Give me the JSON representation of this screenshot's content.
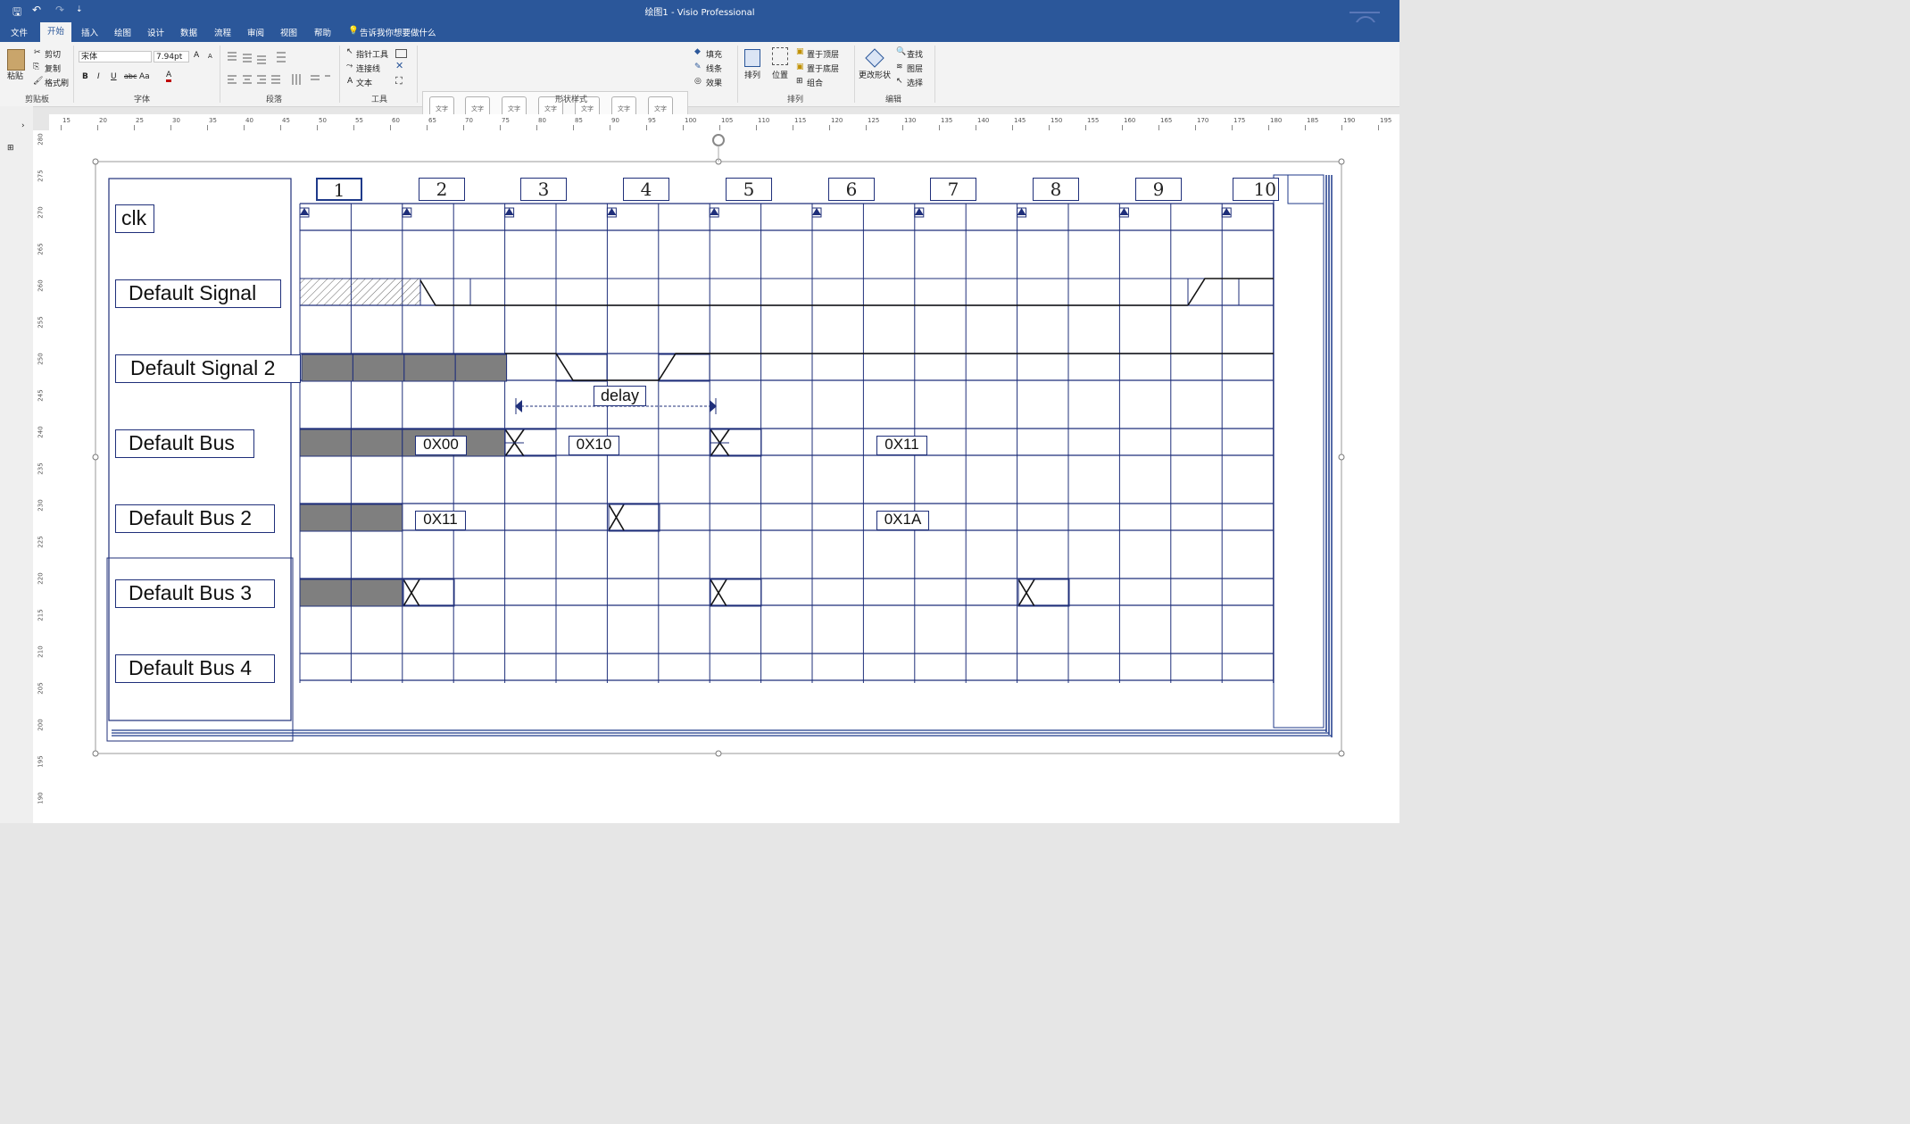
{
  "window": {
    "title": "绘图1  -  Visio Professional"
  },
  "quick_access": {
    "save": "🖫",
    "undo": "↶",
    "redo": "↷",
    "customize": "⇣"
  },
  "tabs": [
    "文件",
    "开始",
    "插入",
    "绘图",
    "设计",
    "数据",
    "流程",
    "审阅",
    "视图",
    "帮助"
  ],
  "active_tab": "开始",
  "tell_me": "告诉我你想要做什么",
  "ribbon": {
    "clipboard": {
      "paste": "粘贴",
      "cut": "剪切",
      "copy": "复制",
      "format_painter": "格式刷",
      "label": "剪贴板"
    },
    "font": {
      "family": "宋体",
      "size": "7.94pt",
      "bold": "B",
      "italic": "I",
      "underline": "U",
      "strike": "abc",
      "case": "Aa",
      "color": "A",
      "grow": "A",
      "shrink": "A",
      "label": "字体"
    },
    "paragraph": {
      "label": "段落"
    },
    "tools": {
      "pointer": "指针工具",
      "connector": "连接线",
      "text": "文本",
      "label": "工具"
    },
    "shape_styles": {
      "swatch": "文字",
      "fill": "填充",
      "line": "线条",
      "effects": "效果",
      "label": "形状样式"
    },
    "arrange": {
      "arrange": "排列",
      "position": "位置",
      "bring_front": "置于顶层",
      "send_back": "置于底层",
      "group": "组合",
      "label": "排列"
    },
    "editing": {
      "change_shape": "更改形状",
      "find": "查找",
      "layers": "图层",
      "select": "选择",
      "label": "编辑"
    }
  },
  "rulers": {
    "h_ticks": [
      "15",
      "20",
      "25",
      "30",
      "35",
      "40",
      "45",
      "50",
      "55",
      "60",
      "65",
      "70",
      "75",
      "80",
      "85",
      "90",
      "95",
      "100",
      "105",
      "110",
      "115",
      "120",
      "125",
      "130",
      "135",
      "140",
      "145",
      "150",
      "155",
      "160",
      "165",
      "170",
      "175",
      "180",
      "185",
      "190",
      "195"
    ],
    "v_ticks": [
      "280",
      "275",
      "270",
      "265",
      "260",
      "255",
      "250",
      "245",
      "240",
      "235",
      "230",
      "225",
      "220",
      "215",
      "210",
      "205",
      "200",
      "195",
      "190"
    ]
  },
  "diagram": {
    "clock_numbers": [
      "1",
      "2",
      "3",
      "4",
      "5",
      "6",
      "7",
      "8",
      "9",
      "10"
    ],
    "clock_label": "clk",
    "signals": [
      {
        "label": "Default Signal"
      },
      {
        "label": "Default Signal 2"
      },
      {
        "label": "Default Bus"
      },
      {
        "label": "Default Bus 2"
      },
      {
        "label": "Default Bus 3"
      },
      {
        "label": "Default Bus 4"
      }
    ],
    "bus_values": {
      "bus1_a": "0X00",
      "bus1_b": "0X10",
      "bus1_c": "0X11",
      "bus2_a": "0X11",
      "bus2_b": "0X1A"
    },
    "delay_label": "delay",
    "colors": {
      "line": "#1f2f7a",
      "fill": "#7f7f7f",
      "ribbon_blue": "#2b579a"
    }
  }
}
